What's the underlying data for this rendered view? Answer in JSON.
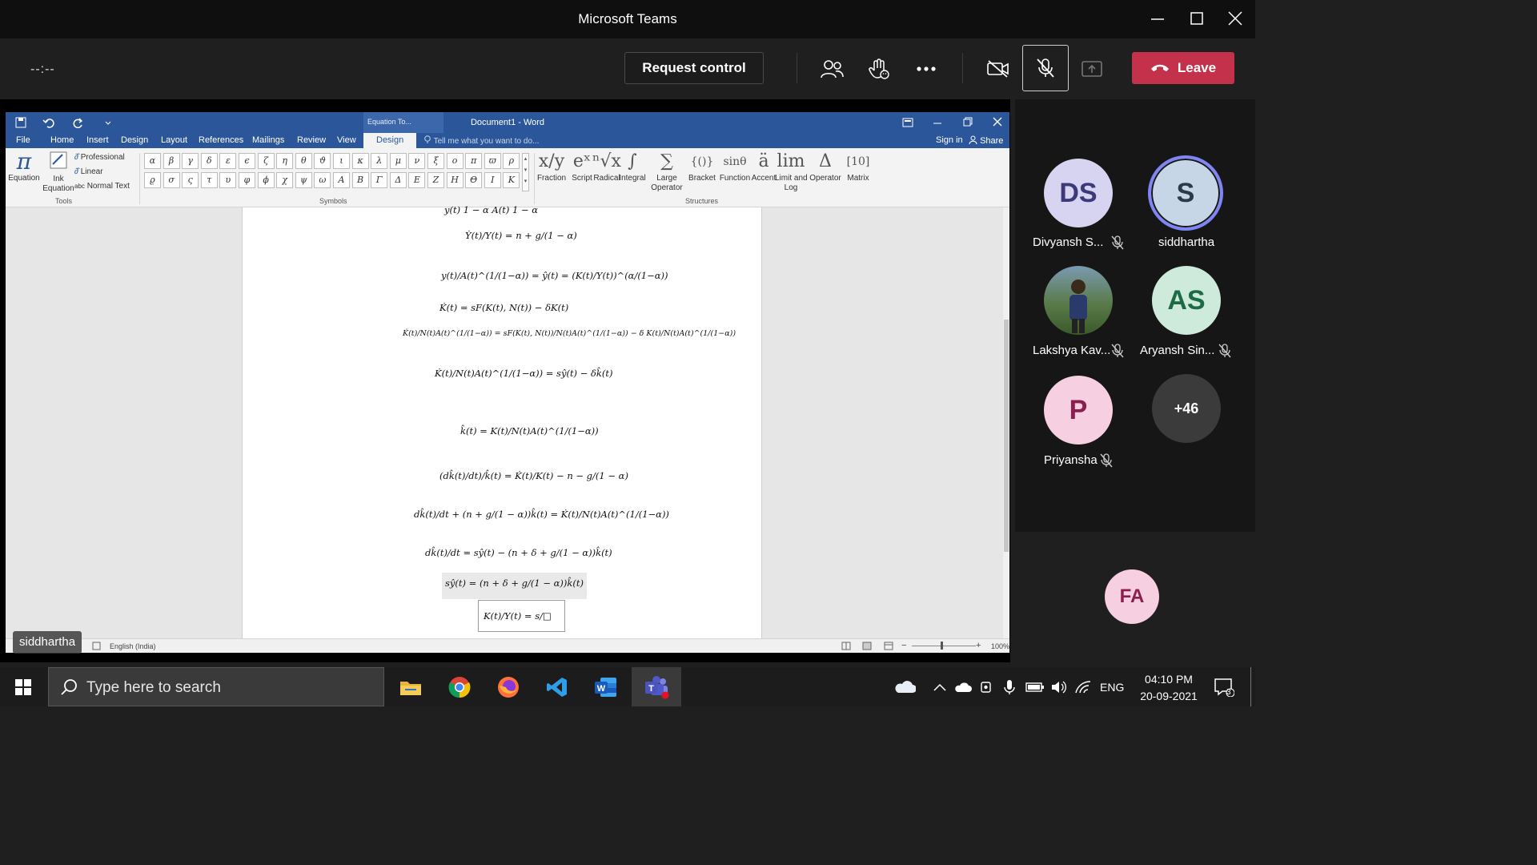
{
  "window": {
    "title": "Microsoft Teams"
  },
  "call": {
    "timer": "--:--",
    "request_control": "Request control",
    "leave": "Leave"
  },
  "word": {
    "doc_title": "Document1 - Word",
    "context_tab": "Equation To...",
    "tabs": [
      "File",
      "Home",
      "Insert",
      "Design",
      "Layout",
      "References",
      "Mailings",
      "Review",
      "View",
      "Design"
    ],
    "tell_me": "Tell me what you want to do...",
    "sign_in": "Sign in",
    "share": "Share",
    "tools": {
      "equation": "Equation",
      "ink_equation_1": "Ink",
      "ink_equation_2": "Equation",
      "professional": "Professional",
      "linear": "Linear",
      "normal_text": "Normal Text",
      "group_label": "Tools"
    },
    "symbols": {
      "row1": [
        "α",
        "β",
        "γ",
        "δ",
        "ε",
        "ϵ",
        "ζ",
        "η",
        "θ",
        "ϑ",
        "ι",
        "κ",
        "λ",
        "μ",
        "ν",
        "ξ",
        "ο",
        "π",
        "ϖ",
        "ρ"
      ],
      "row2": [
        "ϱ",
        "σ",
        "ς",
        "τ",
        "υ",
        "φ",
        "ϕ",
        "χ",
        "ψ",
        "ω",
        "Α",
        "Β",
        "Γ",
        "Δ",
        "Ε",
        "Ζ",
        "Η",
        "Θ",
        "Ι",
        "Κ"
      ],
      "group_label": "Symbols"
    },
    "structures": {
      "items": [
        {
          "glyph": "x/y",
          "label": "Fraction"
        },
        {
          "glyph": "eˣ",
          "label": "Script"
        },
        {
          "glyph": "ⁿ√x",
          "label": "Radical"
        },
        {
          "glyph": "∫",
          "label": "Integral"
        },
        {
          "glyph": "∑",
          "label": "Large\nOperator"
        },
        {
          "glyph": "{()}",
          "label": "Bracket"
        },
        {
          "glyph": "sinθ",
          "label": "Function"
        },
        {
          "glyph": "ä",
          "label": "Accent"
        },
        {
          "glyph": "lim",
          "label": "Limit and\nLog"
        },
        {
          "glyph": "Δ",
          "label": "Operator"
        },
        {
          "glyph": "[10]",
          "label": "Matrix"
        }
      ],
      "group_label": "Structures"
    },
    "equations": [
      "y(t)    1 − α A(t)    1 − α",
      "Ẏ(t)/Y(t) = n + g/(1 − α)",
      "y(t)/A(t)^(1/(1−α)) = ŷ(t) = (K(t)/Y(t))^(α/(1−α))",
      "K̇(t) = sF(K(t), N(t)) − δK(t)",
      "K̇(t)/N(t)A(t)^(1/(1−α)) = sF(K(t), N(t))/N(t)A(t)^(1/(1−α)) − δ K(t)/N(t)A(t)^(1/(1−α))",
      "K̇(t)/N(t)A(t)^(1/(1−α)) = sŷ(t) − δk̂(t)",
      "k̂(t) = K(t)/N(t)A(t)^(1/(1−α))",
      "(dk̂(t)/dt)/k̂(t) = K̇(t)/K(t) − n − g/(1 − α)",
      "dk̂(t)/dt + (n + g/(1 − α))k̂(t) = K̇(t)/N(t)A(t)^(1/(1−α))",
      "dk̂(t)/dt = sŷ(t) − (n + δ + g/(1 − α))k̂(t)",
      "sŷ(t) = (n + δ + g/(1 − α))k̂(t)",
      "K(t)/Y(t) = s/□"
    ],
    "status": {
      "language": "English (India)",
      "zoom": "100%"
    }
  },
  "presenter_tag": "siddhartha",
  "participants": [
    {
      "initials": "DS",
      "name": "Divyansh S...",
      "muted": true,
      "bg": "#d6d4f0",
      "fg": "#3d3a7a"
    },
    {
      "initials": "S",
      "name": "siddhartha",
      "muted": false,
      "bg": "#c7d6e6",
      "fg": "#2a3a4a",
      "speaking": true
    },
    {
      "initials": "",
      "name": "Lakshya Kav...",
      "muted": true,
      "bg": "#6b8a5a",
      "fg": "#fff",
      "photo": true
    },
    {
      "initials": "AS",
      "name": "Aryansh Sin...",
      "muted": true,
      "bg": "#cdeadb",
      "fg": "#1d6b45"
    },
    {
      "initials": "P",
      "name": "Priyansha",
      "muted": true,
      "bg": "#f6cfe0",
      "fg": "#8a1f4f"
    },
    {
      "initials": "+46",
      "name": "",
      "muted": false,
      "bg": "#3b3b3b",
      "fg": "#fff"
    }
  ],
  "self_avatar": {
    "initials": "FA",
    "bg": "#f6cfe0",
    "fg": "#8a1f4f"
  },
  "taskbar": {
    "search_placeholder": "Type here to search",
    "language": "ENG",
    "time": "04:10 PM",
    "date": "20-09-2021",
    "notifications": "3",
    "apps": [
      "file-explorer",
      "chrome",
      "firefox",
      "vscode",
      "word",
      "teams"
    ]
  },
  "colors": {
    "leave": "#c4314b",
    "word_blue": "#2b579a",
    "teams_purple": "#7f85f5"
  }
}
